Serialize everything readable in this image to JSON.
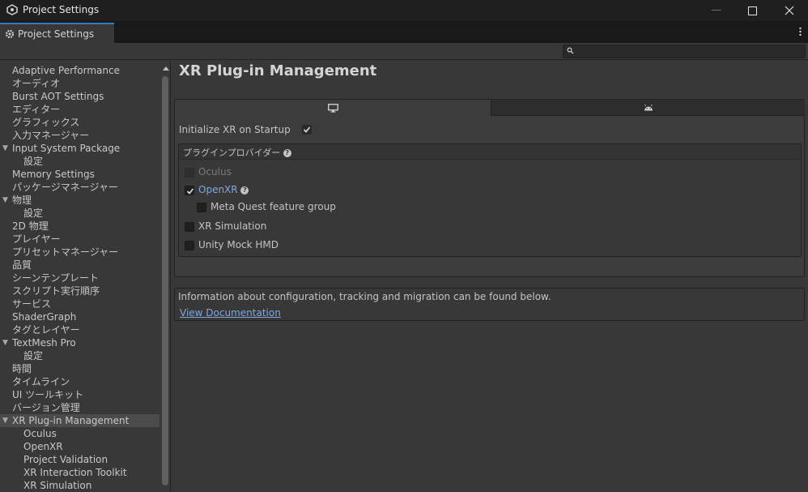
{
  "window": {
    "title": "Project Settings"
  },
  "tab": {
    "label": "Project Settings"
  },
  "search": {
    "placeholder": ""
  },
  "sidebar": {
    "items": [
      {
        "label": "Adaptive Performance",
        "indent": 0
      },
      {
        "label": "オーディオ",
        "indent": 0
      },
      {
        "label": "Burst AOT Settings",
        "indent": 0
      },
      {
        "label": "エディター",
        "indent": 0
      },
      {
        "label": "グラフィックス",
        "indent": 0
      },
      {
        "label": "入力マネージャー",
        "indent": 0
      },
      {
        "label": "Input System Package",
        "indent": 0,
        "expanded": true
      },
      {
        "label": "設定",
        "indent": 1
      },
      {
        "label": "Memory Settings",
        "indent": 0
      },
      {
        "label": "パッケージマネージャー",
        "indent": 0
      },
      {
        "label": "物理",
        "indent": 0,
        "expanded": true
      },
      {
        "label": "設定",
        "indent": 1
      },
      {
        "label": "2D 物理",
        "indent": 0
      },
      {
        "label": "プレイヤー",
        "indent": 0
      },
      {
        "label": "プリセットマネージャー",
        "indent": 0
      },
      {
        "label": "品質",
        "indent": 0
      },
      {
        "label": "シーンテンプレート",
        "indent": 0
      },
      {
        "label": "スクリプト実行順序",
        "indent": 0
      },
      {
        "label": "サービス",
        "indent": 0
      },
      {
        "label": "ShaderGraph",
        "indent": 0
      },
      {
        "label": "タグとレイヤー",
        "indent": 0
      },
      {
        "label": "TextMesh Pro",
        "indent": 0,
        "expanded": true
      },
      {
        "label": "設定",
        "indent": 1
      },
      {
        "label": "時間",
        "indent": 0
      },
      {
        "label": "タイムライン",
        "indent": 0
      },
      {
        "label": "UI ツールキット",
        "indent": 0
      },
      {
        "label": "バージョン管理",
        "indent": 0
      },
      {
        "label": "XR Plug-in Management",
        "indent": 0,
        "expanded": true,
        "selected": true
      },
      {
        "label": "Oculus",
        "indent": 1
      },
      {
        "label": "OpenXR",
        "indent": 1
      },
      {
        "label": "Project Validation",
        "indent": 1
      },
      {
        "label": "XR Interaction Toolkit",
        "indent": 1
      },
      {
        "label": "XR Simulation",
        "indent": 1
      }
    ]
  },
  "main": {
    "title": "XR Plug-in Management",
    "platform_tabs": [
      {
        "icon": "monitor-icon",
        "active": true
      },
      {
        "icon": "android-icon",
        "active": false
      }
    ],
    "init_on_startup": {
      "label": "Initialize XR on Startup",
      "checked": true
    },
    "plugin_providers": {
      "header": "プラグインプロバイダー",
      "items": [
        {
          "label": "Oculus",
          "checked": false,
          "disabled": true
        },
        {
          "label": "OpenXR",
          "checked": true,
          "help": true
        },
        {
          "label": "Meta Quest feature group",
          "checked": false,
          "indent": 1
        },
        {
          "label": "XR Simulation",
          "checked": false
        },
        {
          "label": "Unity Mock HMD",
          "checked": false
        }
      ]
    },
    "info": {
      "text": "Information about configuration, tracking and migration can be found below.",
      "link": "View Documentation"
    }
  },
  "colors": {
    "link": "#7ca8e6",
    "tab_accent": "#3a79bb",
    "background": "#383838"
  }
}
